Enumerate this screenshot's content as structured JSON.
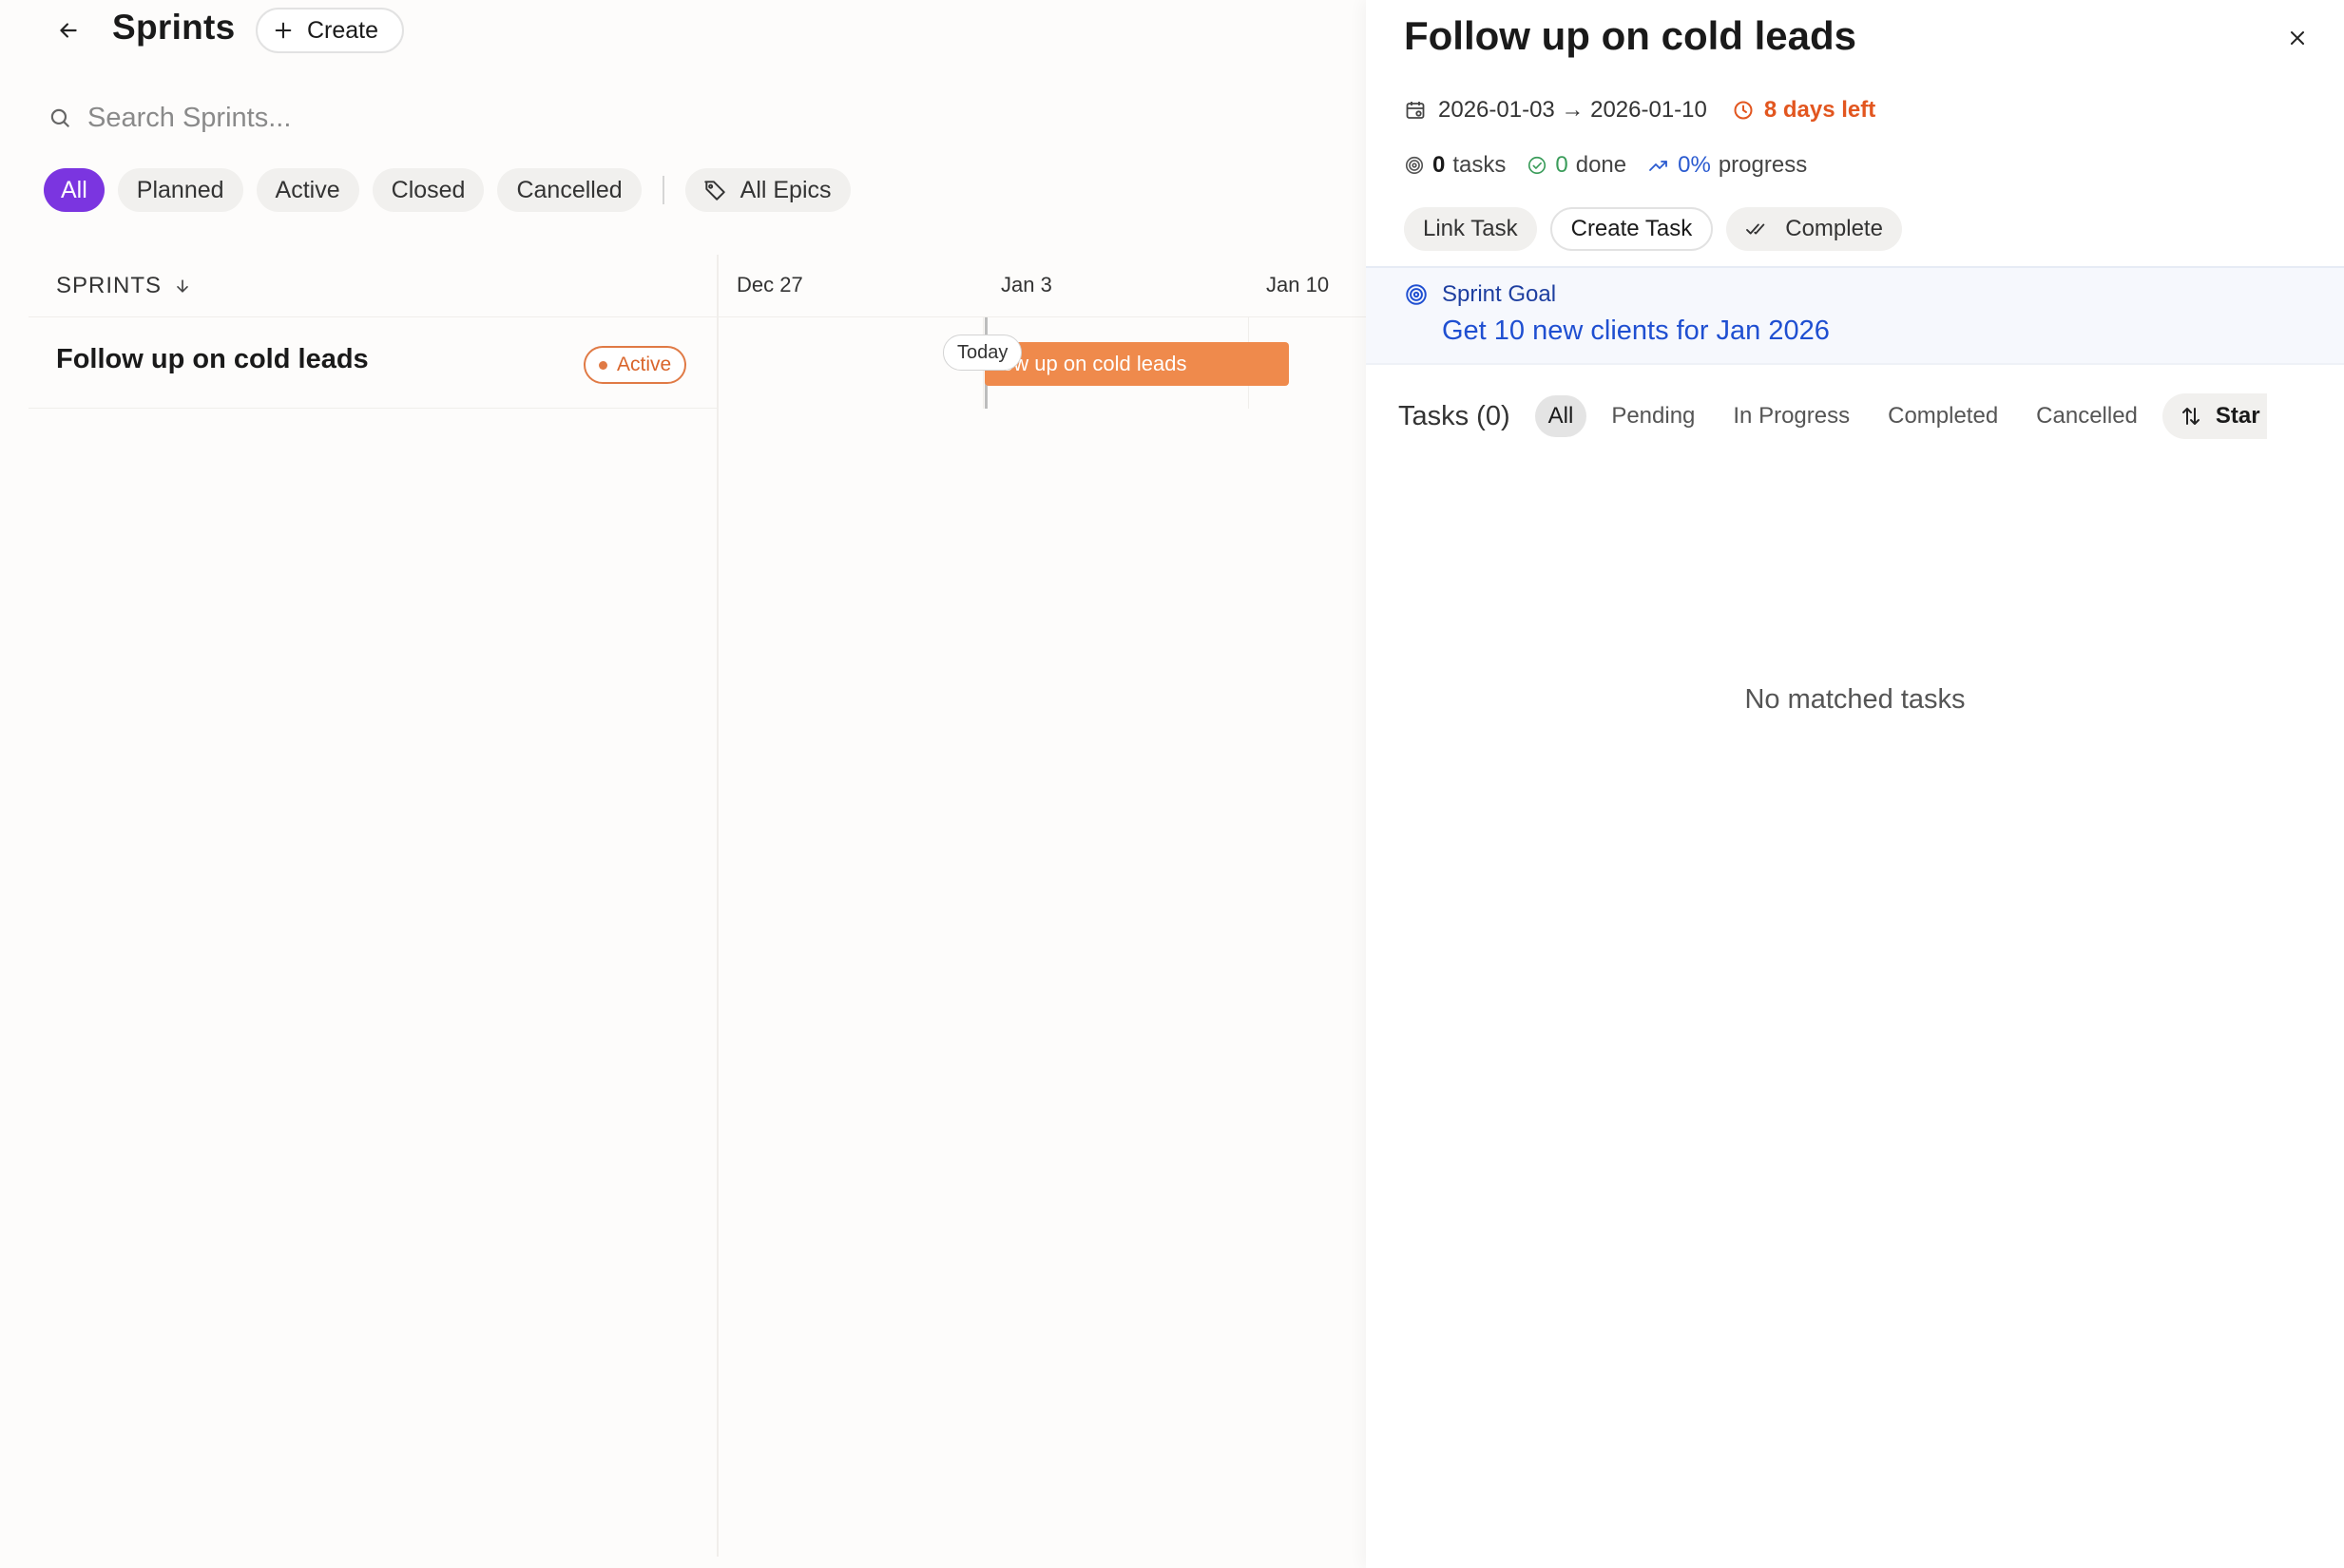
{
  "header": {
    "title": "Sprints",
    "create_label": "Create"
  },
  "search": {
    "placeholder": "Search Sprints..."
  },
  "filters": {
    "chips": [
      "All",
      "Planned",
      "Active",
      "Closed",
      "Cancelled"
    ],
    "epics_label": "All Epics",
    "selected": "All"
  },
  "table": {
    "column_header": "SPRINTS",
    "rows": [
      {
        "title": "Follow up on cold leads",
        "status": "Active"
      }
    ]
  },
  "timeline": {
    "dates": [
      "Dec 27",
      "Jan 3",
      "Jan 10"
    ],
    "today_label": "Today",
    "bar_label": "ollow up on cold leads"
  },
  "panel": {
    "title": "Follow up on cold leads",
    "date_range": "2026-01-03 → 2026-01-10",
    "days_left": "8 days left",
    "task_count": "0",
    "tasks_word": "tasks",
    "done_count": "0",
    "done_word": "done",
    "progress_value": "0%",
    "progress_word": "progress",
    "actions": {
      "link": "Link Task",
      "create": "Create Task",
      "complete": "Complete"
    },
    "goal": {
      "label": "Sprint Goal",
      "text": "Get 10 new clients for Jan 2026"
    },
    "tasks": {
      "title": "Tasks (0)",
      "tabs": [
        "All",
        "Pending",
        "In Progress",
        "Completed",
        "Cancelled"
      ],
      "sort_label": "Star",
      "empty": "No matched tasks"
    }
  },
  "colors": {
    "accent": "#7b35e0",
    "bar": "#ef8a4c",
    "warning": "#e2561f",
    "goal_blue": "#1f4fd1",
    "success": "#3a9c5a"
  }
}
